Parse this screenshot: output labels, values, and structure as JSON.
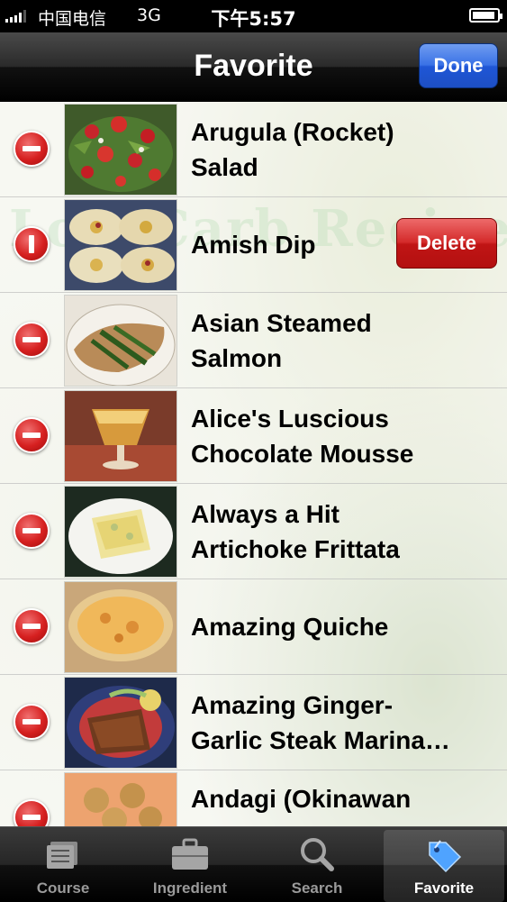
{
  "status_bar": {
    "carrier": "中国电信",
    "network": "3G",
    "time": "下午5:57"
  },
  "nav": {
    "title": "Favorite",
    "done_label": "Done"
  },
  "watermark": "Low-Carb Recipes",
  "recipes": [
    {
      "line1": "Arugula (Rocket)",
      "line2": "Salad",
      "thumb": "salad-photo"
    },
    {
      "line1": "Amish Dip",
      "line2": "",
      "thumb": "stuffed-eggs-photo",
      "delete_label": "Delete"
    },
    {
      "line1": "Asian Steamed",
      "line2": "Salmon",
      "thumb": "salmon-photo"
    },
    {
      "line1": "Alice's Luscious",
      "line2": "Chocolate Mousse",
      "thumb": "mousse-photo"
    },
    {
      "line1": "Always a Hit",
      "line2": "Artichoke Frittata",
      "thumb": "frittata-photo"
    },
    {
      "line1": "Amazing Quiche",
      "line2": "",
      "thumb": "quiche-photo"
    },
    {
      "line1": "Amazing Ginger-",
      "line2": "Garlic Steak Marina…",
      "thumb": "steak-photo"
    },
    {
      "line1": "Andagi (Okinawan",
      "line2": "",
      "thumb": "andagi-photo"
    }
  ],
  "tabs": [
    {
      "label": "Course",
      "icon": "course-icon"
    },
    {
      "label": "Ingredient",
      "icon": "briefcase-icon"
    },
    {
      "label": "Search",
      "icon": "search-icon"
    },
    {
      "label": "Favorite",
      "icon": "tag-icon",
      "active": true
    }
  ],
  "colors": {
    "done_button": "#2a62de",
    "delete_button": "#cc1f1f",
    "minus_badge": "#d62020"
  }
}
